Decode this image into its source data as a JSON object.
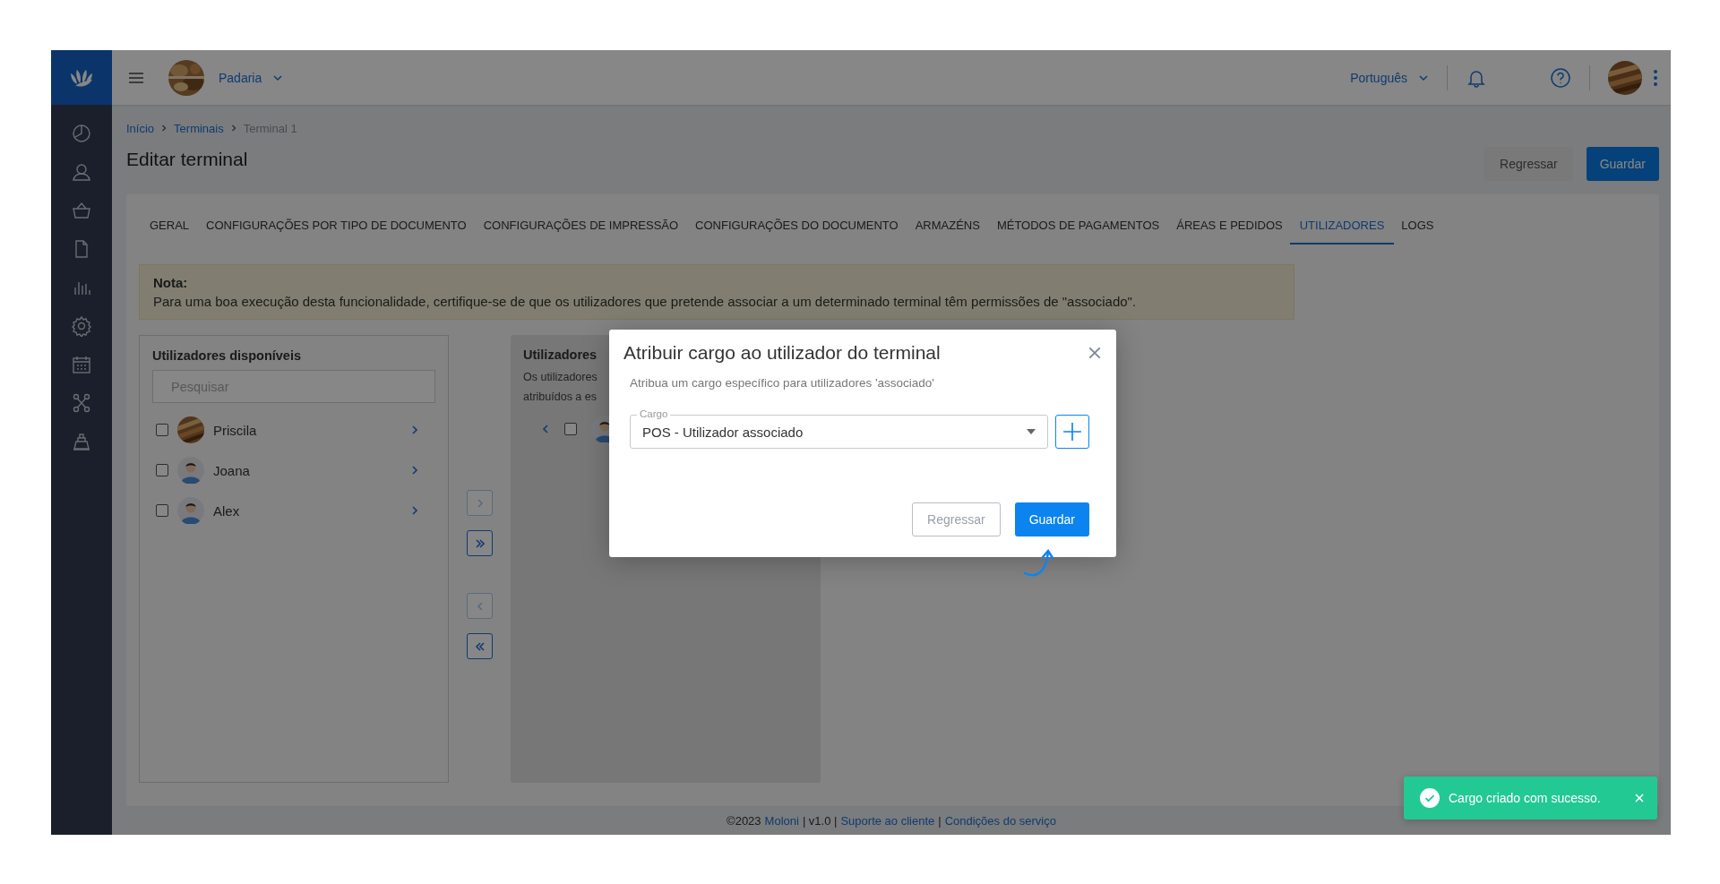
{
  "topbar": {
    "company": "Padaria",
    "language": "Português"
  },
  "breadcrumb": [
    {
      "label": "Início",
      "link": true
    },
    {
      "label": "Terminais",
      "link": true
    },
    {
      "label": "Terminal 1",
      "link": false
    }
  ],
  "page_title": "Editar terminal",
  "header_buttons": [
    {
      "label": "Regressar",
      "kind": "secondary"
    },
    {
      "label": "Guardar",
      "kind": "primary"
    }
  ],
  "tabs": [
    {
      "label": "GERAL",
      "selected": false
    },
    {
      "label": "CONFIGURAÇÕES POR TIPO DE DOCUMENTO",
      "selected": false
    },
    {
      "label": "CONFIGURAÇÕES DE IMPRESSÃO",
      "selected": false
    },
    {
      "label": "CONFIGURAÇÕES DO DOCUMENTO",
      "selected": false
    },
    {
      "label": "ARMAZÉNS",
      "selected": false
    },
    {
      "label": "MÉTODOS DE PAGAMENTOS",
      "selected": false
    },
    {
      "label": "ÁREAS E PEDIDOS",
      "selected": false
    },
    {
      "label": "UTILIZADORES",
      "selected": true
    },
    {
      "label": "LOGS",
      "selected": false
    }
  ],
  "note": {
    "title": "Nota:",
    "text": "Para uma boa execução desta funcionalidade, certifique-se de que os utilizadores que pretende associar a um determinado terminal têm permissões de \"associado\"."
  },
  "available": {
    "title": "Utilizadores disponíveis",
    "search": {
      "placeholder": "Pesquisar"
    },
    "users": [
      {
        "name": "Priscila",
        "checked": false
      },
      {
        "name": "Joana",
        "checked": false,
        "kind": "person"
      },
      {
        "name": "Alex",
        "checked": false,
        "kind": "person"
      }
    ]
  },
  "transfer_buttons": [
    {
      "kind": "one-right",
      "disabled": true
    },
    {
      "kind": "all-right",
      "disabled": false
    },
    {
      "kind": "one-left",
      "disabled": true
    },
    {
      "kind": "all-left",
      "disabled": false
    }
  ],
  "assigned": {
    "title": "Utilizadores",
    "lines": [
      "Os utilizadores",
      "atribuídos a es"
    ],
    "users": [
      {
        "checked": false,
        "kind": "person"
      }
    ]
  },
  "modal": {
    "title": "Atribuir cargo ao utilizador do terminal",
    "subtitle": "Atribua um cargo específico para utilizadores 'associado'",
    "field": {
      "label": "Cargo",
      "value": "POS - Utilizador associado"
    },
    "buttons": [
      {
        "label": "Regressar",
        "kind": "secondary"
      },
      {
        "label": "Guardar",
        "kind": "primary"
      }
    ]
  },
  "footer": [
    {
      "text": "©2023",
      "link": false
    },
    {
      "text": "Moloni",
      "link": true
    },
    {
      "text": "| v1.0 |",
      "link": false
    },
    {
      "text": "Suporte ao cliente",
      "link": true
    },
    {
      "text": "|",
      "link": false
    },
    {
      "text": "Condições do serviço",
      "link": true
    }
  ],
  "toast": {
    "message": "Cargo criado com sucesso."
  }
}
